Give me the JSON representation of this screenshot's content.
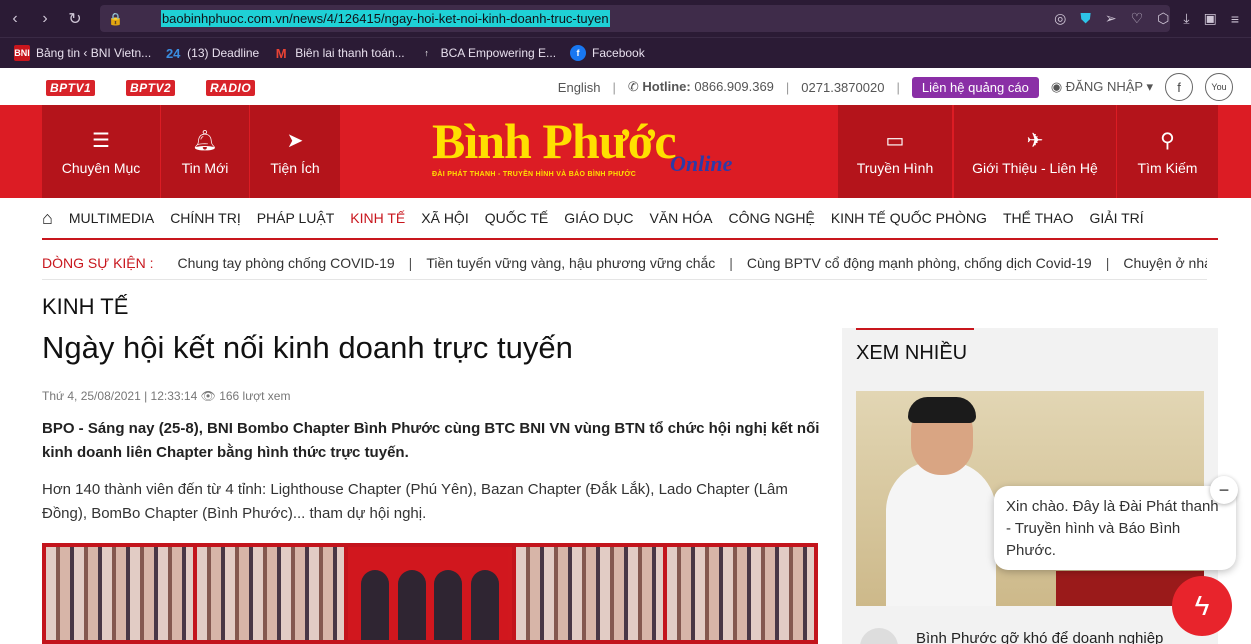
{
  "browser": {
    "url": "baobinhphuoc.com.vn/news/4/126415/ngay-hoi-ket-noi-kinh-doanh-truc-tuyen",
    "bookmarks": [
      {
        "label": "Bảng tin ‹ BNI Vietn...",
        "icon": "BNI"
      },
      {
        "label": "(13) Deadline",
        "icon": "24"
      },
      {
        "label": "Biên lai thanh toán...",
        "icon": "M"
      },
      {
        "label": "BCA Empowering E...",
        "icon": "↑"
      },
      {
        "label": "Facebook",
        "icon": "f"
      }
    ]
  },
  "topbar": {
    "channels": [
      "BPTV1",
      "BPTV2",
      "RADIO"
    ],
    "english": "English",
    "hotline_label": "Hotline:",
    "hotline": "0866.909.369",
    "phone2": "0271.3870020",
    "ad_button": "Liên hệ quảng cáo",
    "login": "ĐĂNG NHẬP"
  },
  "header": {
    "nav_left": [
      {
        "label": "Chuyên Mục",
        "icon": "menu-icon"
      },
      {
        "label": "Tin Mới",
        "icon": "bell-icon"
      },
      {
        "label": "Tiện Ích",
        "icon": "cursor-icon"
      }
    ],
    "nav_right": [
      {
        "label": "Truyền Hình",
        "icon": "tv-icon"
      },
      {
        "label": "Giới Thiệu - Liên Hệ",
        "icon": "send-icon"
      },
      {
        "label": "Tìm Kiếm",
        "icon": "search-icon"
      }
    ],
    "logo_main": "Bình Phước",
    "logo_online": "Online",
    "logo_sub": "ĐÀI PHÁT THANH - TRUYỀN HÌNH VÀ BÁO BÌNH PHƯỚC"
  },
  "menu": [
    "MULTIMEDIA",
    "CHÍNH TRỊ",
    "PHÁP LUẬT",
    "KINH TẾ",
    "XÃ HỘI",
    "QUỐC TẾ",
    "GIÁO DỤC",
    "VĂN HÓA",
    "CÔNG NGHỆ",
    "KINH TẾ QUỐC PHÒNG",
    "THỂ THAO",
    "GIẢI TRÍ"
  ],
  "events": {
    "label": "DÒNG SỰ KIỆN :",
    "items": [
      "Chung tay phòng chống COVID-19",
      "Tiền tuyến vững vàng, hậu phương vững chắc",
      "Cùng BPTV cổ động mạnh phòng, chống dịch Covid-19",
      "Chuyện ở nhà ng"
    ]
  },
  "article": {
    "category": "KINH TẾ",
    "title": "Ngày hội kết nối kinh doanh trực tuyến",
    "date": "Thứ 4, 25/08/2021 | 12:33:14",
    "views": "166 lượt xem",
    "lead": "BPO - Sáng nay (25-8), BNI Bombo Chapter Bình Phước cùng BTC BNI VN vùng BTN tổ chức hội nghị kết nối kinh doanh liên Chapter bằng hình thức trực tuyến.",
    "para": "Hơn 140 thành viên đến từ 4 tỉnh: Lighthouse Chapter (Phú Yên), Bazan Chapter (Đắk Lắk), Lado Chapter (Lâm Đồng), BomBo Chapter (Bình Phước)... tham dự hội nghị."
  },
  "sidebar": {
    "title": "XEM NHIỀU",
    "next_item": "Bình Phước gỡ khó để doanh nghiệp"
  },
  "chat": {
    "message": "Xin chào. Đây là Đài Phát thanh - Truyền hình và Báo Bình Phước."
  }
}
